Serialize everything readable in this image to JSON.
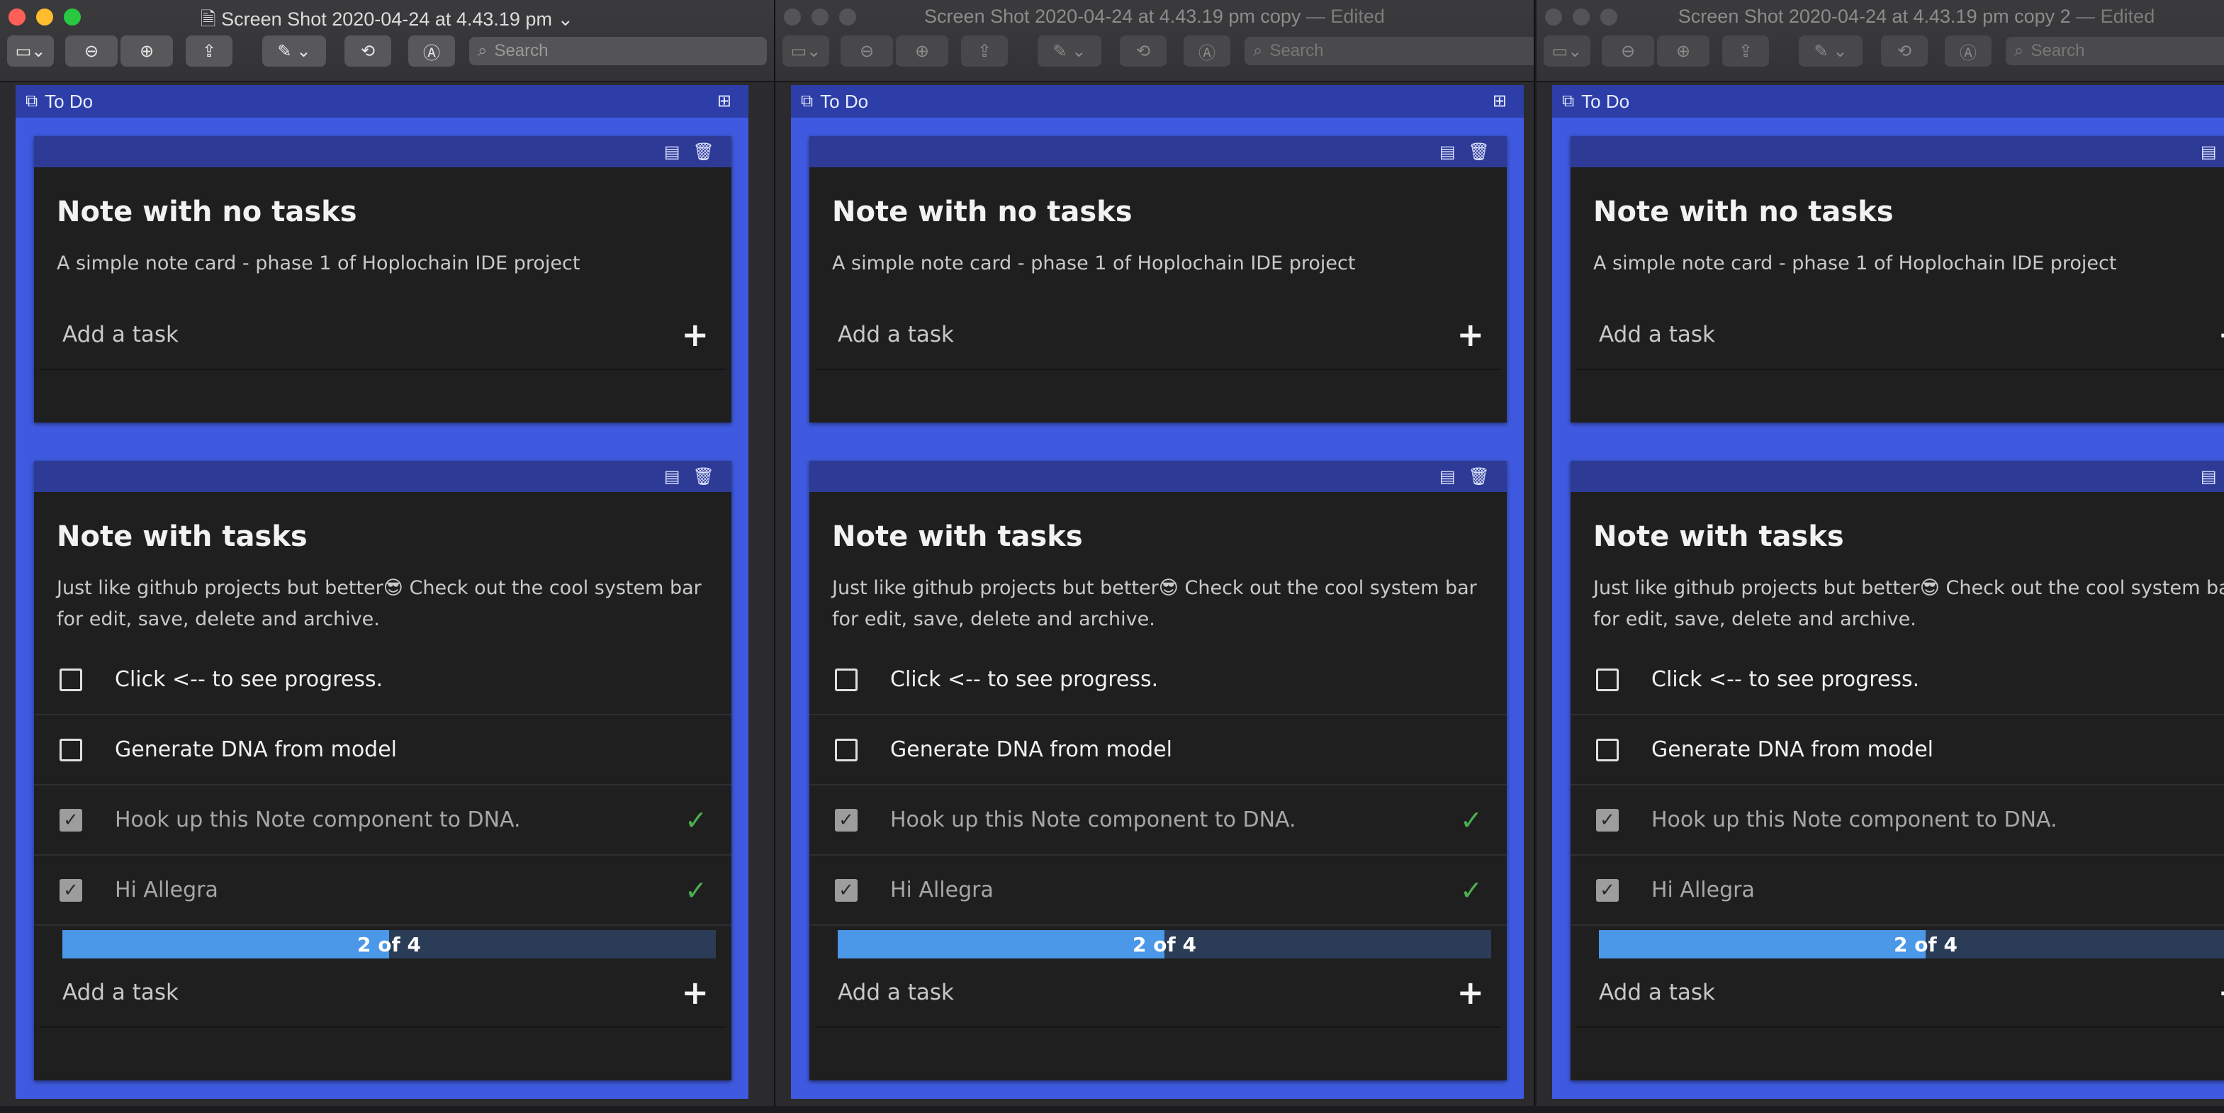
{
  "windows": [
    {
      "title": "Screen Shot 2020-04-24 at 4.43.19 pm",
      "title_suffix": "",
      "chevron": "⌄",
      "active": true
    },
    {
      "title": "Screen Shot 2020-04-24 at 4.43.19 pm copy",
      "title_suffix": " — Edited",
      "chevron": "",
      "active": false
    },
    {
      "title": "Screen Shot 2020-04-24 at 4.43.19 pm copy 2",
      "title_suffix": " — Edited",
      "chevron": "",
      "active": false
    }
  ],
  "toolbar": {
    "search_placeholder": "Search",
    "icons": [
      "sidebar-icon",
      "zoom-out-icon",
      "zoom-in-icon",
      "share-icon",
      "markup-pen-icon",
      "rotate-icon",
      "annotate-icon",
      "search-icon"
    ]
  },
  "column": {
    "title": "To Do"
  },
  "note1": {
    "title": "Note with no tasks",
    "description": "A simple note card - phase 1 of Hoplochain IDE project",
    "add_task_label": "Add a task"
  },
  "note2": {
    "title": "Note with tasks",
    "description": "Just like github projects but better😎 Check out the cool system bar for edit, save, delete and archive.",
    "tasks": [
      {
        "label": "Click <-- to see progress.",
        "done": false
      },
      {
        "label": "Generate DNA from model",
        "done": false
      },
      {
        "label": "Hook up this Note component to DNA.",
        "done": true
      },
      {
        "label": "Hi Allegra",
        "done": true
      }
    ],
    "progress_label": "2 of 4",
    "progress_fraction": 0.5,
    "add_task_label": "Add a task"
  },
  "colors": {
    "column_bg": "#3f5ae0",
    "card_bar": "#2e3b96",
    "progress_fill": "#4b97e8",
    "done_tick": "#4caf50"
  }
}
